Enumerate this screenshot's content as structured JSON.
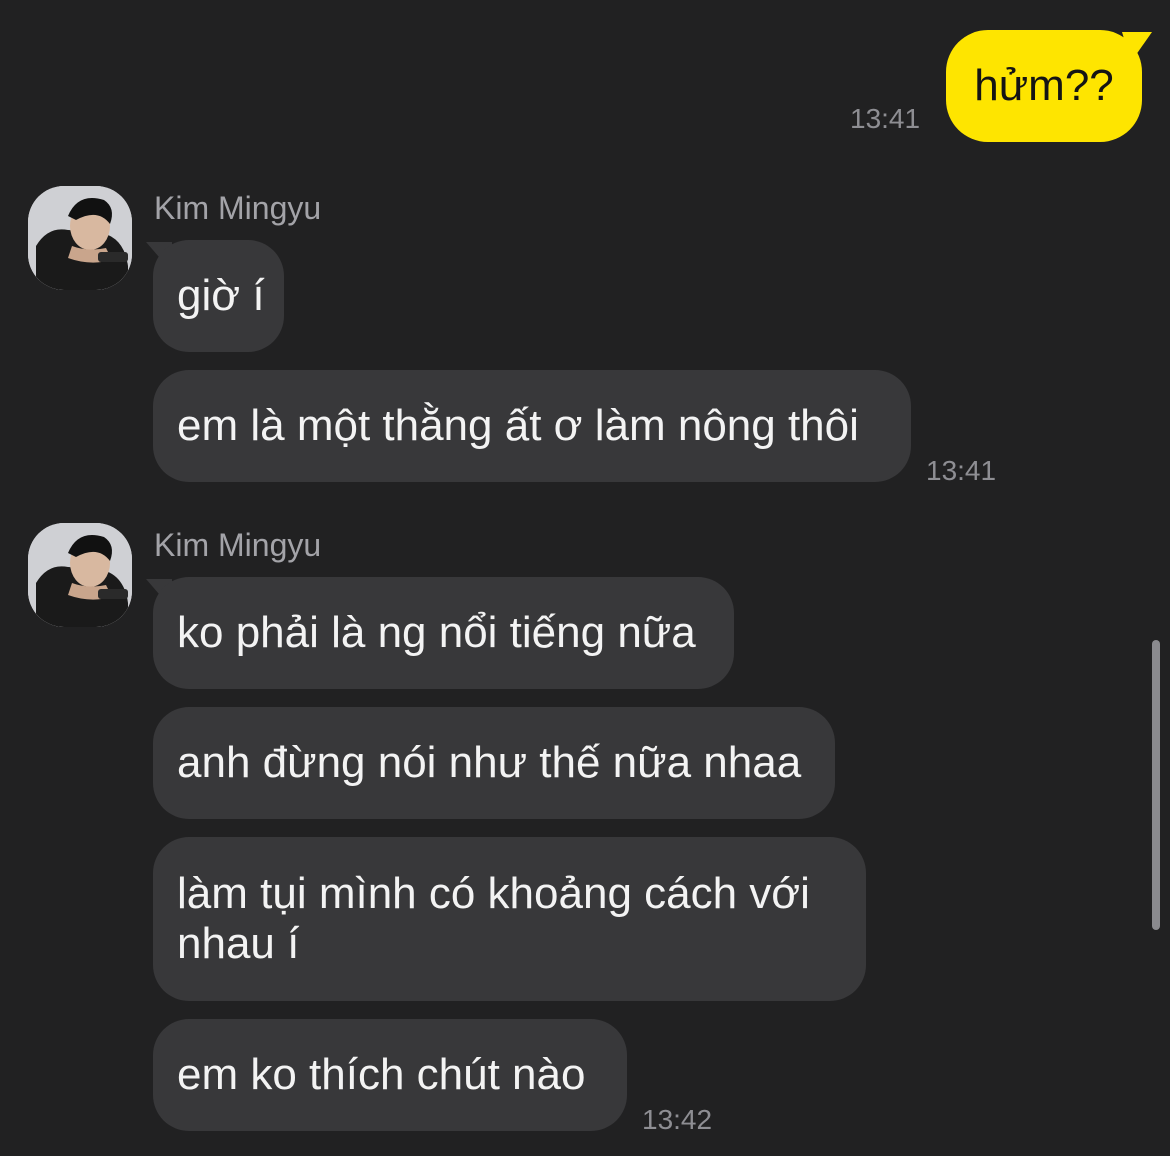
{
  "outgoing": {
    "text": "hửm??",
    "time": "13:41"
  },
  "groups": [
    {
      "sender": "Kim Mingyu",
      "messages": [
        "giờ í",
        "em là một thằng ất ơ làm nông thôi"
      ],
      "time": "13:41"
    },
    {
      "sender": "Kim Mingyu",
      "messages": [
        "ko phải là ng nổi tiếng nữa",
        "anh đừng nói như thế nữa nhaa",
        "làm tụi mình có khoảng cách với nhau í",
        "em ko thích chút nào"
      ],
      "time": "13:42"
    }
  ],
  "colors": {
    "background": "#212122",
    "incoming_bubble": "#38383a",
    "outgoing_bubble": "#fee500",
    "timestamp": "#8e8e93"
  },
  "icons": {
    "avatar": "person-photo-avatar"
  }
}
